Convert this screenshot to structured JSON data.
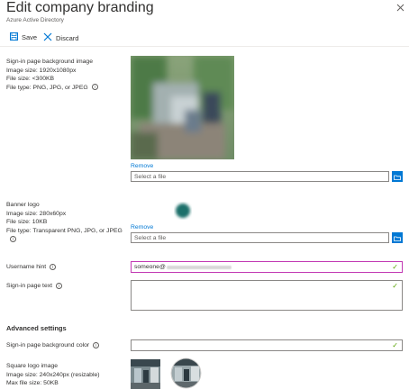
{
  "header": {
    "title": "Edit company branding",
    "subtitle": "Azure Active Directory"
  },
  "toolbar": {
    "save_label": "Save",
    "discard_label": "Discard"
  },
  "background_image": {
    "label": "Sign-in page background image",
    "size": "Image size: 1920x1080px",
    "file_size": "File size: <300KB",
    "file_type": "File type: PNG, JPG, or JPEG",
    "remove_label": "Remove",
    "placeholder": "Select a file"
  },
  "banner_logo": {
    "label": "Banner logo",
    "size": "Image size: 280x60px",
    "file_size": "File size: 10KB",
    "file_type": "File type: Transparent PNG, JPG, or JPEG",
    "remove_label": "Remove",
    "placeholder": "Select a file"
  },
  "username_hint": {
    "label": "Username hint",
    "value": "someone@"
  },
  "signin_text": {
    "label": "Sign-in page text",
    "value": ""
  },
  "advanced": {
    "heading": "Advanced settings",
    "bg_color_label": "Sign-in page background color",
    "bg_color_value": ""
  },
  "square_logo": {
    "label": "Square logo image",
    "size": "Image size: 240x240px (resizable)",
    "file_size": "Max file size: 50KB"
  },
  "colors": {
    "accent": "#0078d4",
    "valid": "#57a300",
    "focus_border": "#c239b3"
  }
}
